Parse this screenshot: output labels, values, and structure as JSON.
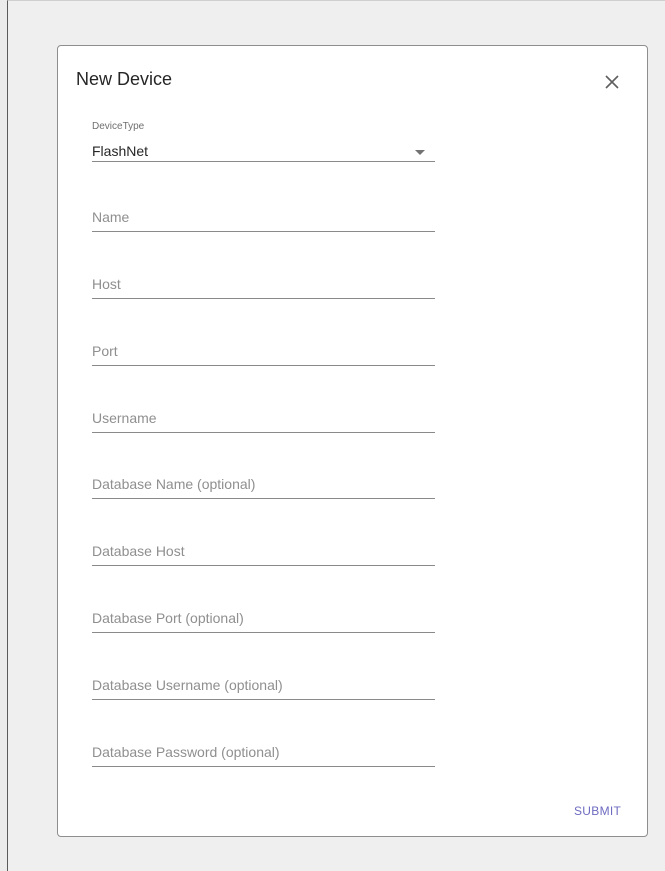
{
  "dialog": {
    "title": "New Device",
    "close_icon": "close-icon",
    "device_type": {
      "label": "DeviceType",
      "value": "FlashNet",
      "icon": "dropdown-arrow-icon"
    },
    "fields": {
      "name": {
        "placeholder": "Name",
        "value": ""
      },
      "host": {
        "placeholder": "Host",
        "value": ""
      },
      "port": {
        "placeholder": "Port",
        "value": ""
      },
      "username": {
        "placeholder": "Username",
        "value": ""
      },
      "database_name": {
        "placeholder": "Database Name (optional)",
        "value": ""
      },
      "database_host": {
        "placeholder": "Database Host",
        "value": ""
      },
      "database_port": {
        "placeholder": "Database Port (optional)",
        "value": ""
      },
      "database_username": {
        "placeholder": "Database Username (optional)",
        "value": ""
      },
      "database_password": {
        "placeholder": "Database Password (optional)",
        "value": ""
      }
    },
    "submit_label": "SUBMIT"
  },
  "colors": {
    "accent": "#6e6bc1",
    "text": "#262626",
    "placeholder": "#8f8f8f",
    "underline": "#8a8a8a"
  }
}
